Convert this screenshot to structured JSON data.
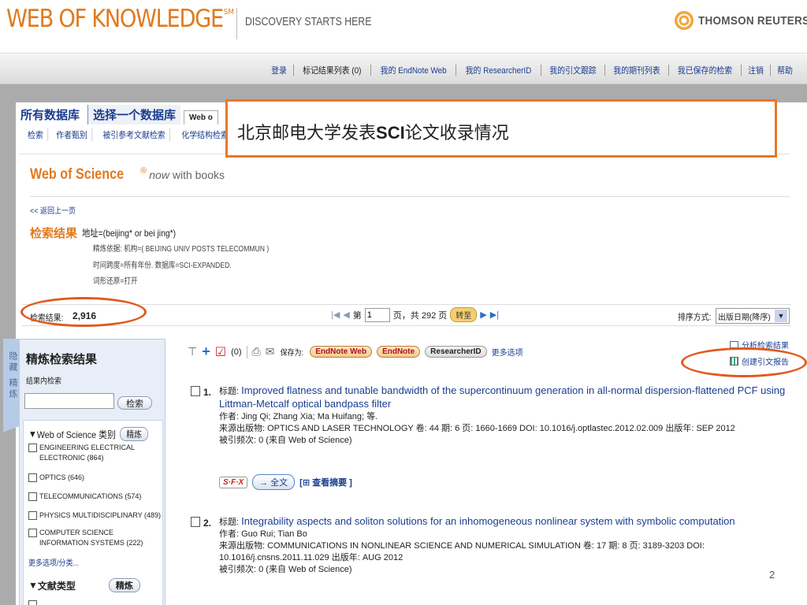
{
  "header": {
    "logo": "WEB OF KNOWLEDGE",
    "logo_sup": "SM",
    "tagline": "DISCOVERY STARTS HERE",
    "brand": "THOMSON REUTERS"
  },
  "topnav": [
    "登录",
    "标记结果列表 (0)",
    "我的 EndNote Web",
    "我的 ResearcherID",
    "我的引文跟踪",
    "我的期刊列表",
    "我已保存的检索",
    "注销",
    "帮助"
  ],
  "db_tabs": {
    "all": "所有数据库",
    "one": "选择一个数据库",
    "wos": "Web o"
  },
  "sub_tabs": [
    "检索",
    "作者甄别",
    "被引参考文献检索",
    "化学结构检索"
  ],
  "overlay": {
    "text_pre": "北京邮电大学发表",
    "text_bold": "SCI",
    "text_post": "论文收录情况"
  },
  "wos": {
    "title": "Web of Science",
    "reg": "®",
    "now": "now",
    "with": " with books"
  },
  "back_link": "<< 返回上一页",
  "result": {
    "label": "检索结果",
    "query": "地址=(beijing* or bei jing*)",
    "refined": "精炼依据: 机构=( BEIJING UNIV POSTS TELECOMMUN )",
    "span": "时间跨度=所有年份. 数据库=SCI-EXPANDED.",
    "lemma": "词形还原=打开"
  },
  "countbar": {
    "label": "检索结果:",
    "value": "2,916",
    "page_pre": "第",
    "page_value": "1",
    "page_post": "页，共 292 页",
    "go": "转至",
    "sort_label": "排序方式:",
    "sort_value": "出版日期(降序)"
  },
  "sidebar": {
    "vtab": "隐藏 精炼",
    "title": "精炼检索结果",
    "sub": "结果内检索",
    "search_btn": "检索",
    "cat_label": "Web of Science 类别",
    "refine_btn": "精炼",
    "categories": [
      "ENGINEERING ELECTRICAL ELECTRONIC (864)",
      "OPTICS (646)",
      "TELECOMMUNICATIONS (574)",
      "PHYSICS MULTIDISCIPLINARY (489)",
      "COMPUTER SCIENCE INFORMATION SYSTEMS (222)"
    ],
    "more": "更多选项/分类...",
    "doctype_label": "文献类型",
    "doctype_btn": "精炼"
  },
  "toolbar": {
    "marked": "(0)",
    "save_label": "保存为:",
    "endnote_web": "EndNote Web",
    "endnote": "EndNote",
    "researcherid": "ResearcherID",
    "more": "更多选项",
    "analyze": "分析检索结果",
    "citation": "创建引文报告"
  },
  "records": [
    {
      "num": "1.",
      "title_label": "标题:",
      "title": "Improved flatness and tunable bandwidth of the supercontinuum generation in all-normal dispersion-flattened PCF using Littman-Metcalf optical bandpass filter",
      "authors": "作者: Jing Qi; Zhang Xia; Ma Huifang; 等.",
      "source": "来源出版物: OPTICS AND LASER TECHNOLOGY  卷: 44  期: 6  页: 1660-1669  DOI: 10.1016/j.optlastec.2012.02.009  出版年: SEP 2012",
      "cited": "被引频次: 0 (来自 Web of Science)",
      "sfx": "S·F·X",
      "fulltext": "→ 全文",
      "abstract": "[⊞ 查看摘要 ]"
    },
    {
      "num": "2.",
      "title_label": "标题:",
      "title": "Integrability aspects and soliton solutions for an inhomogeneous nonlinear system with symbolic computation",
      "authors": "作者: Guo Rui; Tian Bo",
      "source": "来源出版物: COMMUNICATIONS IN NONLINEAR SCIENCE AND NUMERICAL SIMULATION  卷: 17  期: 8  页: 3189-3203  DOI: 10.1016/j.cnsns.2011.11.029  出版年: AUG 2012",
      "cited": "被引频次: 0 (来自 Web of Science)"
    }
  ],
  "page_number": "2"
}
